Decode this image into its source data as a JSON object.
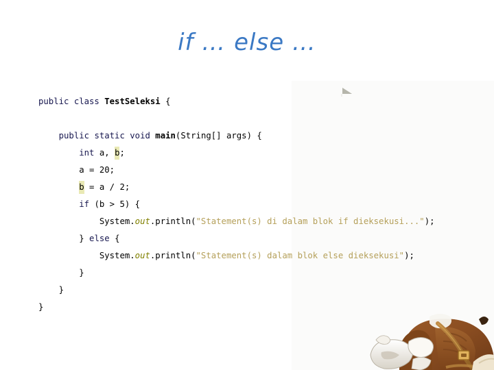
{
  "slide": {
    "title": "if … else …",
    "background_color": "#ffffff",
    "title_color": "#3b79c4"
  },
  "code": {
    "language": "java",
    "highlight_color": "#e9e9b4",
    "keyword_color": "#17174f",
    "string_color": "#b5a05a",
    "field_color": "#808000",
    "lines": [
      {
        "indent": 0,
        "tokens": [
          {
            "text": "public class ",
            "style": "kw"
          },
          {
            "text": "TestSeleksi",
            "style": "cls"
          },
          {
            "text": " {",
            "style": "plain"
          }
        ]
      },
      {
        "indent": 0,
        "tokens": []
      },
      {
        "indent": 1,
        "tokens": [
          {
            "text": "public static void ",
            "style": "kw"
          },
          {
            "text": "main",
            "style": "mth"
          },
          {
            "text": "(String[] args) {",
            "style": "plain"
          }
        ]
      },
      {
        "indent": 2,
        "tokens": [
          {
            "text": "int",
            "style": "kw"
          },
          {
            "text": " a, ",
            "style": "plain"
          },
          {
            "text": "b",
            "style": "plain",
            "highlight": true
          },
          {
            "text": ";",
            "style": "plain"
          }
        ]
      },
      {
        "indent": 2,
        "tokens": [
          {
            "text": "a = 20;",
            "style": "plain"
          }
        ]
      },
      {
        "indent": 2,
        "tokens": [
          {
            "text": "b",
            "style": "plain",
            "highlight": true
          },
          {
            "text": " = a / 2;",
            "style": "plain"
          }
        ]
      },
      {
        "indent": 2,
        "tokens": [
          {
            "text": "if",
            "style": "kw"
          },
          {
            "text": " (b > 5) {",
            "style": "plain"
          }
        ]
      },
      {
        "indent": 3,
        "tokens": [
          {
            "text": "System.",
            "style": "plain"
          },
          {
            "text": "out",
            "style": "fld"
          },
          {
            "text": ".println(",
            "style": "plain"
          },
          {
            "text": "\"Statement(s) di dalam blok if dieksekusi...\"",
            "style": "str"
          },
          {
            "text": ");",
            "style": "plain"
          }
        ]
      },
      {
        "indent": 2,
        "tokens": [
          {
            "text": "} ",
            "style": "plain"
          },
          {
            "text": "else",
            "style": "kw"
          },
          {
            "text": " {",
            "style": "plain"
          }
        ]
      },
      {
        "indent": 3,
        "tokens": [
          {
            "text": "System.",
            "style": "plain"
          },
          {
            "text": "out",
            "style": "fld"
          },
          {
            "text": ".println(",
            "style": "plain"
          },
          {
            "text": "\"Statement(s) dalam blok else dieksekusi\"",
            "style": "str"
          },
          {
            "text": ");",
            "style": "plain"
          }
        ]
      },
      {
        "indent": 2,
        "tokens": [
          {
            "text": "}",
            "style": "plain"
          }
        ]
      },
      {
        "indent": 1,
        "tokens": [
          {
            "text": "}",
            "style": "plain"
          }
        ]
      },
      {
        "indent": 0,
        "tokens": [
          {
            "text": "}",
            "style": "plain"
          }
        ]
      }
    ]
  },
  "decorations": {
    "gray_marker": "gray-triangle-artifact",
    "character": "cartoon-horse-character"
  }
}
